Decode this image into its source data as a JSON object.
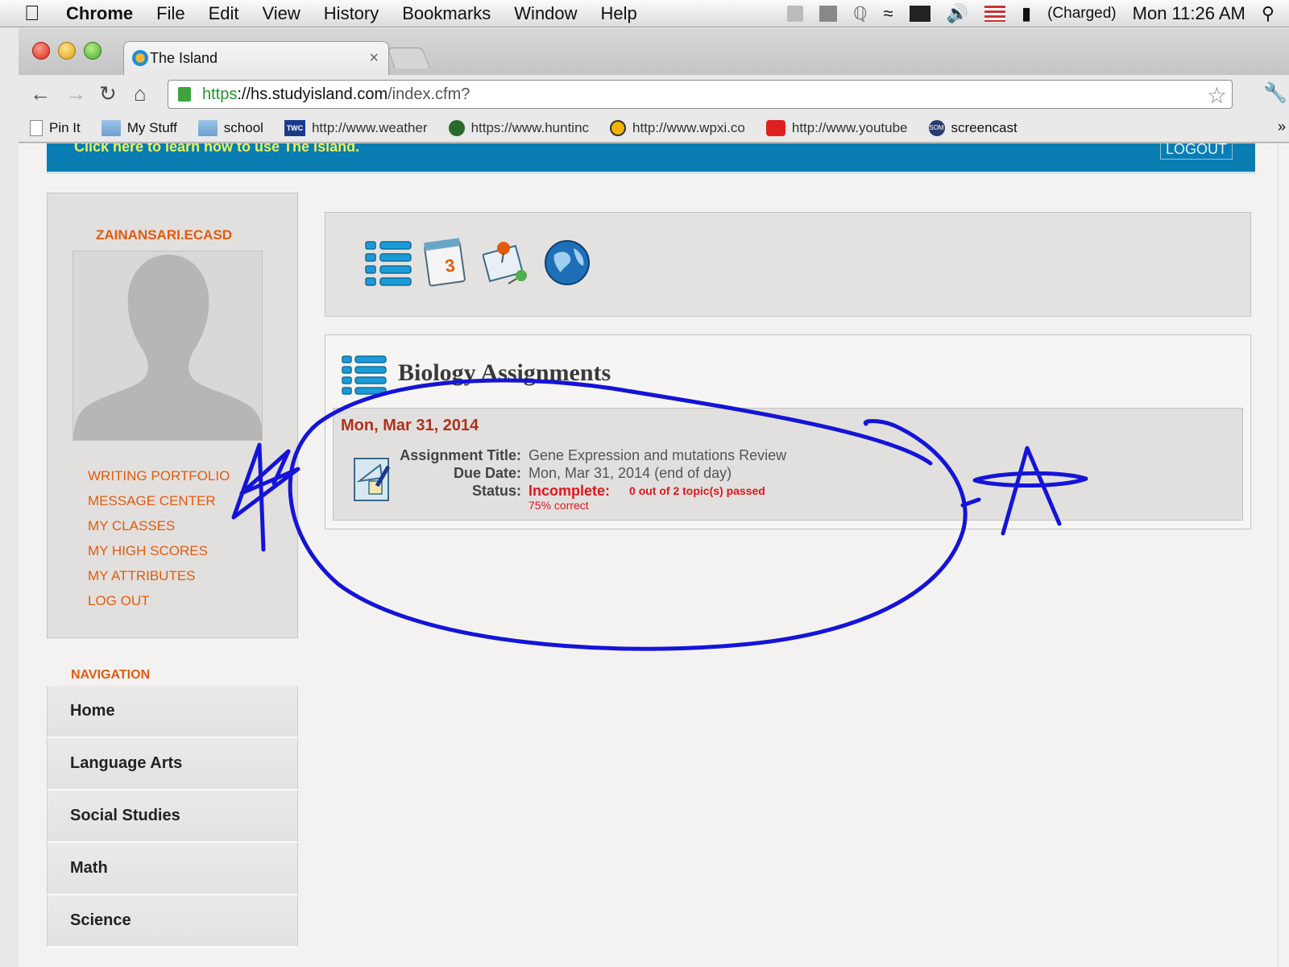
{
  "menubar": {
    "app": "Chrome",
    "menus": [
      "File",
      "Edit",
      "View",
      "History",
      "Bookmarks",
      "Window",
      "Help"
    ],
    "battery": "(Charged)",
    "clock": "Mon 11:26 AM"
  },
  "tab": {
    "title": "The Island",
    "close": "×"
  },
  "omnibox": {
    "scheme": "https",
    "host_prefix": "://",
    "host": "hs.studyisland.com",
    "path": "/index.cfm?"
  },
  "bookmarks": [
    {
      "label": "Pin It",
      "icon": "page-icon"
    },
    {
      "label": "My Stuff",
      "icon": "folder-icon"
    },
    {
      "label": "school",
      "icon": "folder-icon"
    },
    {
      "label": "http://www.weather",
      "icon": "twc-icon",
      "icon_text": "TWC"
    },
    {
      "label": "https://www.huntinc",
      "icon": "hunting-icon"
    },
    {
      "label": "http://www.wpxi.co",
      "icon": "wpxi-icon"
    },
    {
      "label": "http://www.youtube",
      "icon": "youtube-icon"
    },
    {
      "label": "screencast",
      "icon": "screencast-icon",
      "icon_text": "SOM"
    }
  ],
  "banner": {
    "help_text": "Click here to learn how to use The Island.",
    "logout": "LOGOUT"
  },
  "profile": {
    "username": "ZAINANSARI.ECASD",
    "links": [
      "WRITING PORTFOLIO",
      "MESSAGE CENTER",
      "MY CLASSES",
      "MY HIGH SCORES",
      "MY ATTRIBUTES",
      "LOG OUT"
    ]
  },
  "navigation": {
    "title": "NAVIGATION",
    "items": [
      "Home",
      "Language Arts",
      "Social Studies",
      "Math",
      "Science"
    ]
  },
  "assignments": {
    "heading": "Biology Assignments",
    "date": "Mon, Mar 31, 2014",
    "labels": {
      "title": "Assignment Title:",
      "due": "Due Date:",
      "status": "Status:"
    },
    "title_value": "Gene Expression and mutations Review",
    "due_value": "Mon, Mar 31, 2014 (end of day)",
    "status_value": "Incomplete:",
    "passed": "0 out of 2 topic(s) passed",
    "percent": "75% correct"
  },
  "colors": {
    "accent_orange": "#e25b0e",
    "banner_blue": "#0a7db2",
    "status_red": "#e0151b",
    "ink_blue": "#1414d8"
  }
}
